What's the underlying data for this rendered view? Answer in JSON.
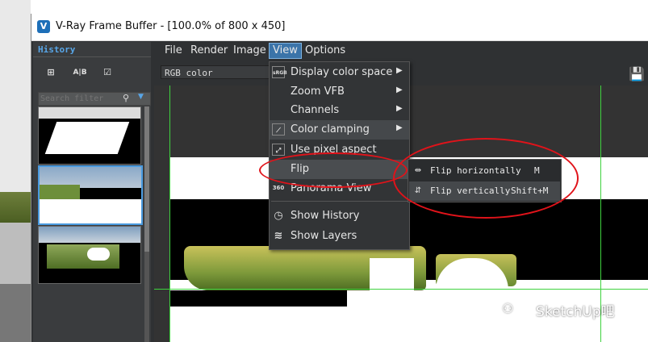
{
  "window": {
    "title": "V-Ray Frame Buffer - [100.0% of 800 x 450]",
    "logo": "V"
  },
  "history": {
    "title": "History",
    "toolbar": [
      {
        "icon": "add-history-icon",
        "glyph": "⊞"
      },
      {
        "icon": "ab-compare-icon",
        "glyph": "A|B"
      },
      {
        "icon": "checklist-icon",
        "glyph": "☑"
      }
    ],
    "search_placeholder": "Search filter"
  },
  "menubar": {
    "items": [
      "File",
      "Render",
      "Image",
      "View",
      "Options"
    ]
  },
  "toolbar": {
    "channel": "RGB color"
  },
  "view_menu": {
    "items": [
      {
        "label": "Display color space",
        "icon": "rgb-icon",
        "glyph": "sRGB",
        "submenu": true
      },
      {
        "label": "Zoom VFB",
        "icon": "",
        "submenu": true
      },
      {
        "label": "Channels",
        "icon": "",
        "submenu": true
      },
      {
        "label": "Color clamping",
        "icon": "clamp-icon",
        "glyph": "⟋",
        "submenu": true
      },
      {
        "label": "Use pixel aspect",
        "icon": "pixel-aspect-icon",
        "glyph": "⤢",
        "submenu": false
      },
      {
        "label": "Flip",
        "icon": "",
        "submenu": true
      },
      {
        "label": "Panorama View",
        "icon": "panorama-icon",
        "glyph": "360",
        "submenu": false
      },
      {
        "label": "Show History",
        "icon": "history-icon",
        "glyph": "◷",
        "submenu": false
      },
      {
        "label": "Show Layers",
        "icon": "layers-icon",
        "glyph": "≋",
        "submenu": false
      }
    ]
  },
  "flip_submenu": {
    "items": [
      {
        "label": "Flip horizontally",
        "shortcut": "M",
        "icon": "flip-horizontal-icon",
        "glyph": "⇹"
      },
      {
        "label": "Flip vertically",
        "shortcut": "Shift+M",
        "icon": "flip-vertical-icon",
        "glyph": "⇵"
      }
    ]
  },
  "watermark": {
    "text": "SketchUp吧",
    "icon": "wechat-icon",
    "glyph": "⚇"
  },
  "colors": {
    "accent": "#3b74a9",
    "annotation": "#e0131a",
    "guide": "#3fd23f",
    "history_title": "#58a6e8"
  }
}
